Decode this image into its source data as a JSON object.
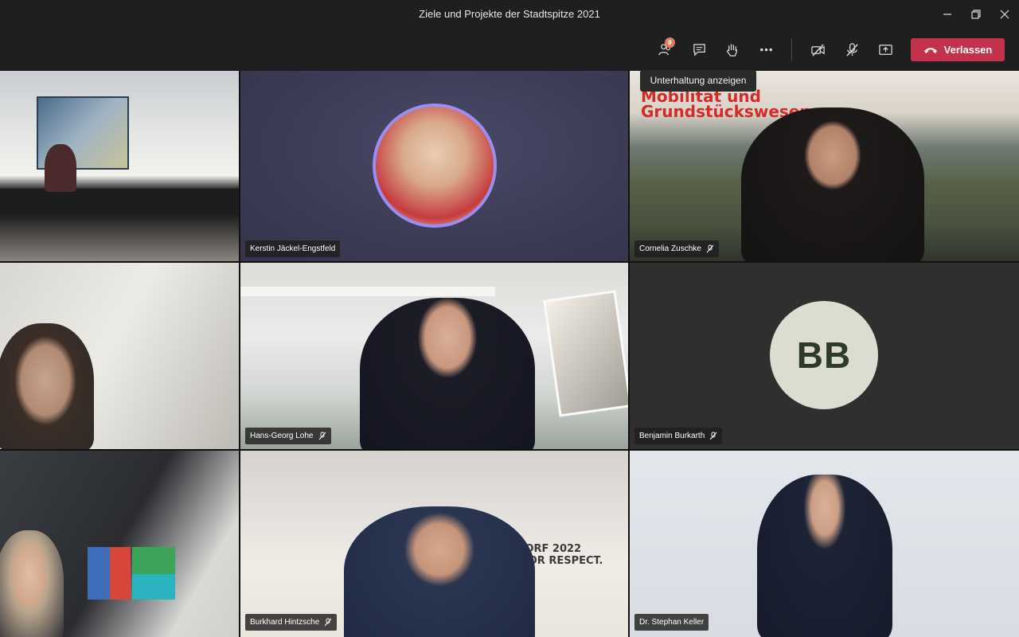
{
  "window": {
    "title": "Ziele und Projekte der Stadtspitze 2021"
  },
  "toolbar": {
    "participants_badge": "8",
    "leave_label": "Verlassen"
  },
  "tooltip": {
    "text": "Unterhaltung anzeigen"
  },
  "colors": {
    "leave_button": "#c4314b",
    "avatar_ring": "#9b8ef0",
    "badge": "#e27a5f"
  },
  "participants": [
    {
      "name": "",
      "muted": false
    },
    {
      "name": "Kerstin Jäckel-Engstfeld",
      "muted": false
    },
    {
      "name": "Cornelia Zuschke",
      "muted": true,
      "background_text": "auen,\nMobilität und\nGrundstückswesen"
    },
    {
      "name": "",
      "muted": false
    },
    {
      "name": "Hans-Georg Lohe",
      "muted": true
    },
    {
      "name": "Benjamin Burkarth",
      "muted": true,
      "initials": "BB"
    },
    {
      "name": "",
      "muted": false
    },
    {
      "name": "Burkhard Hintzsche",
      "muted": true,
      "background_text": "DÜSSELDORF 2022\nA HOME FOR RESPECT."
    },
    {
      "name": "Dr. Stephan Keller",
      "muted": false
    }
  ]
}
